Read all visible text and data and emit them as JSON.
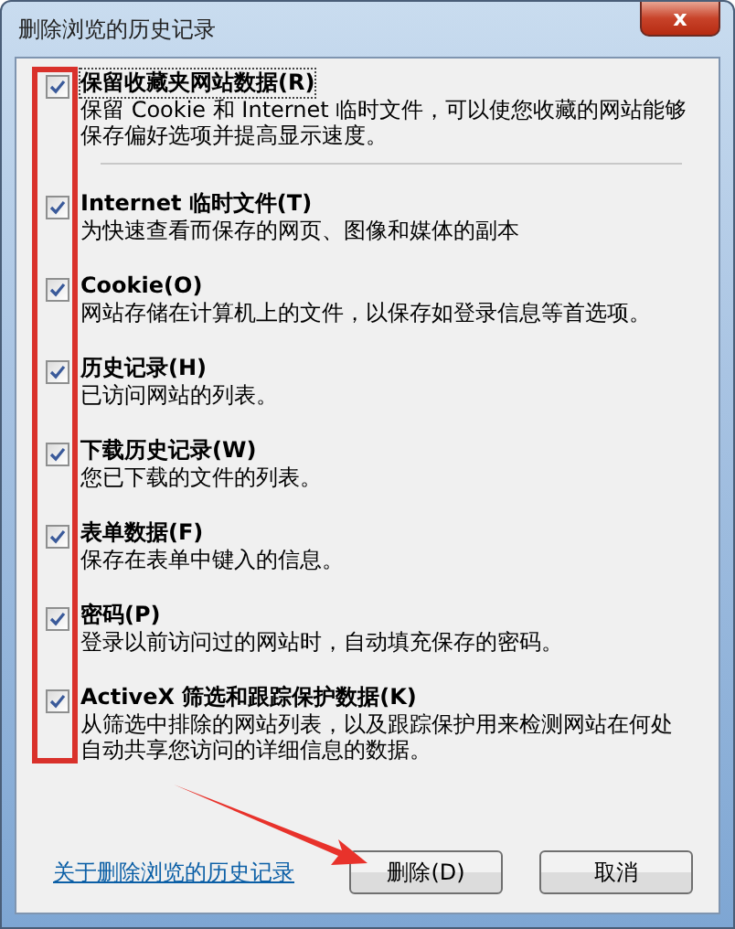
{
  "window": {
    "title": "删除浏览的历史记录",
    "close": "x"
  },
  "options": [
    {
      "label": "保留收藏夹网站数据(R)",
      "description": "保留 Cookie 和 Internet 临时文件，可以使您收藏的网站能够保存偏好选项并提高显示速度。",
      "checked": true,
      "focused": true
    },
    {
      "label": "Internet 临时文件(T)",
      "description": "为快速查看而保存的网页、图像和媒体的副本",
      "checked": true,
      "focused": false
    },
    {
      "label": "Cookie(O)",
      "description": "网站存储在计算机上的文件，以保存如登录信息等首选项。",
      "checked": true,
      "focused": false
    },
    {
      "label": "历史记录(H)",
      "description": "已访问网站的列表。",
      "checked": true,
      "focused": false
    },
    {
      "label": "下载历史记录(W)",
      "description": "您已下载的文件的列表。",
      "checked": true,
      "focused": false
    },
    {
      "label": "表单数据(F)",
      "description": "保存在表单中键入的信息。",
      "checked": true,
      "focused": false
    },
    {
      "label": "密码(P)",
      "description": "登录以前访问过的网站时，自动填充保存的密码。",
      "checked": true,
      "focused": false
    },
    {
      "label": "ActiveX 筛选和跟踪保护数据(K)",
      "description": "从筛选中排除的网站列表，以及跟踪保护用来检测网站在何处自动共享您访问的详细信息的数据。",
      "checked": true,
      "focused": false
    }
  ],
  "footer": {
    "link": "关于删除浏览的历史记录",
    "buttons": [
      "删除(D)",
      "取消"
    ]
  }
}
